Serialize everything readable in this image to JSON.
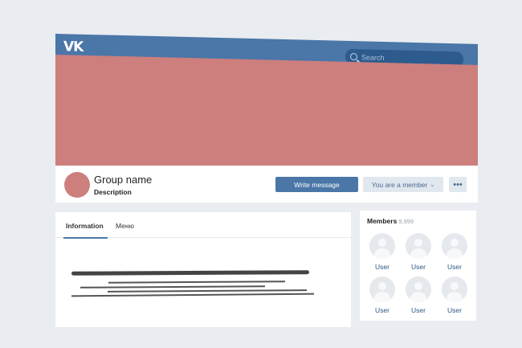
{
  "header": {
    "logo_text": "VK",
    "search_placeholder": "Search"
  },
  "profile": {
    "group_name": "Group name",
    "description": "Description",
    "write_message_label": "Write message",
    "member_status_label": "You are a member",
    "more_label": "•••"
  },
  "info": {
    "tabs": [
      {
        "label": "Information",
        "active": true
      },
      {
        "label": "Меню",
        "active": false
      }
    ]
  },
  "members": {
    "title": "Members",
    "count": "9,999",
    "users": [
      {
        "label": "User"
      },
      {
        "label": "User"
      },
      {
        "label": "User"
      },
      {
        "label": "User"
      },
      {
        "label": "User"
      },
      {
        "label": "User"
      }
    ]
  },
  "colors": {
    "brand": "#4a76a8",
    "cover": "#cc7f7d",
    "background": "#e9ecf0"
  }
}
